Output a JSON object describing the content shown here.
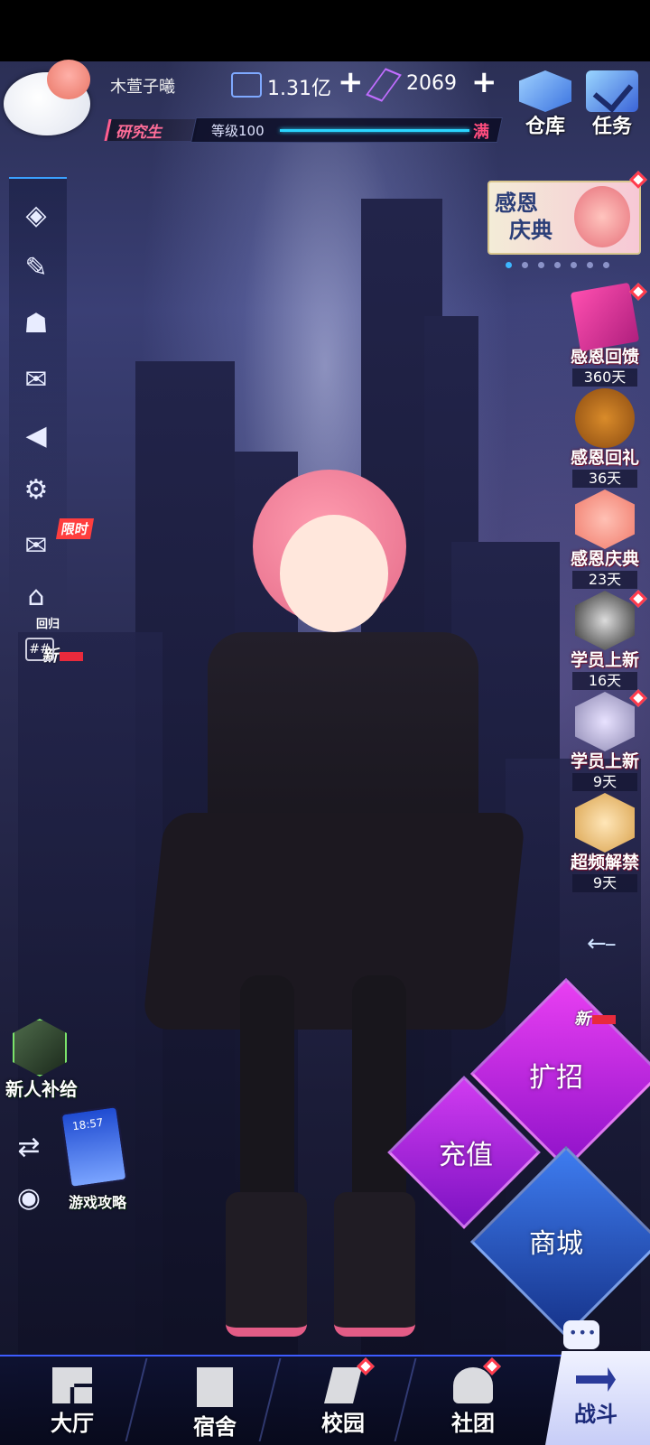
{
  "player": {
    "name": "木萱子曦",
    "rank": "研究生",
    "level_label": "等级100",
    "level_max_label": "满"
  },
  "currency": {
    "coins": "1.31亿",
    "gems": "2069",
    "plus": "+"
  },
  "top_buttons": {
    "warehouse": "仓库",
    "tasks": "任务"
  },
  "sidebar": {
    "limited_tag": "限时",
    "return_label": "回归",
    "new_tag": "新",
    "hashtag": "##"
  },
  "banner": {
    "title_line1": "感恩",
    "title_line2": "庆典"
  },
  "events": [
    {
      "name": "感恩回馈",
      "days": "360天"
    },
    {
      "name": "感恩回礼",
      "days": "36天"
    },
    {
      "name": "感恩庆典",
      "days": "23天"
    },
    {
      "name": "学员上新",
      "days": "16天"
    },
    {
      "name": "学员上新",
      "days": "9天"
    },
    {
      "name": "超频解禁",
      "days": "9天"
    }
  ],
  "left_bottom": {
    "newbie_supply": "新人补给",
    "game_guide": "游戏攻略",
    "phone_time": "18:57"
  },
  "actions": {
    "recruit": "扩招",
    "recharge": "充值",
    "shop": "商城",
    "new_tag": "新"
  },
  "nav": {
    "hall": "大厅",
    "dorm": "宿舍",
    "campus": "校园",
    "club": "社团",
    "battle": "战斗"
  },
  "colors": {
    "accent": "#3d5cff",
    "pink": "#ff4d7e",
    "purple": "#b01fd6",
    "blue": "#2a58c8"
  }
}
